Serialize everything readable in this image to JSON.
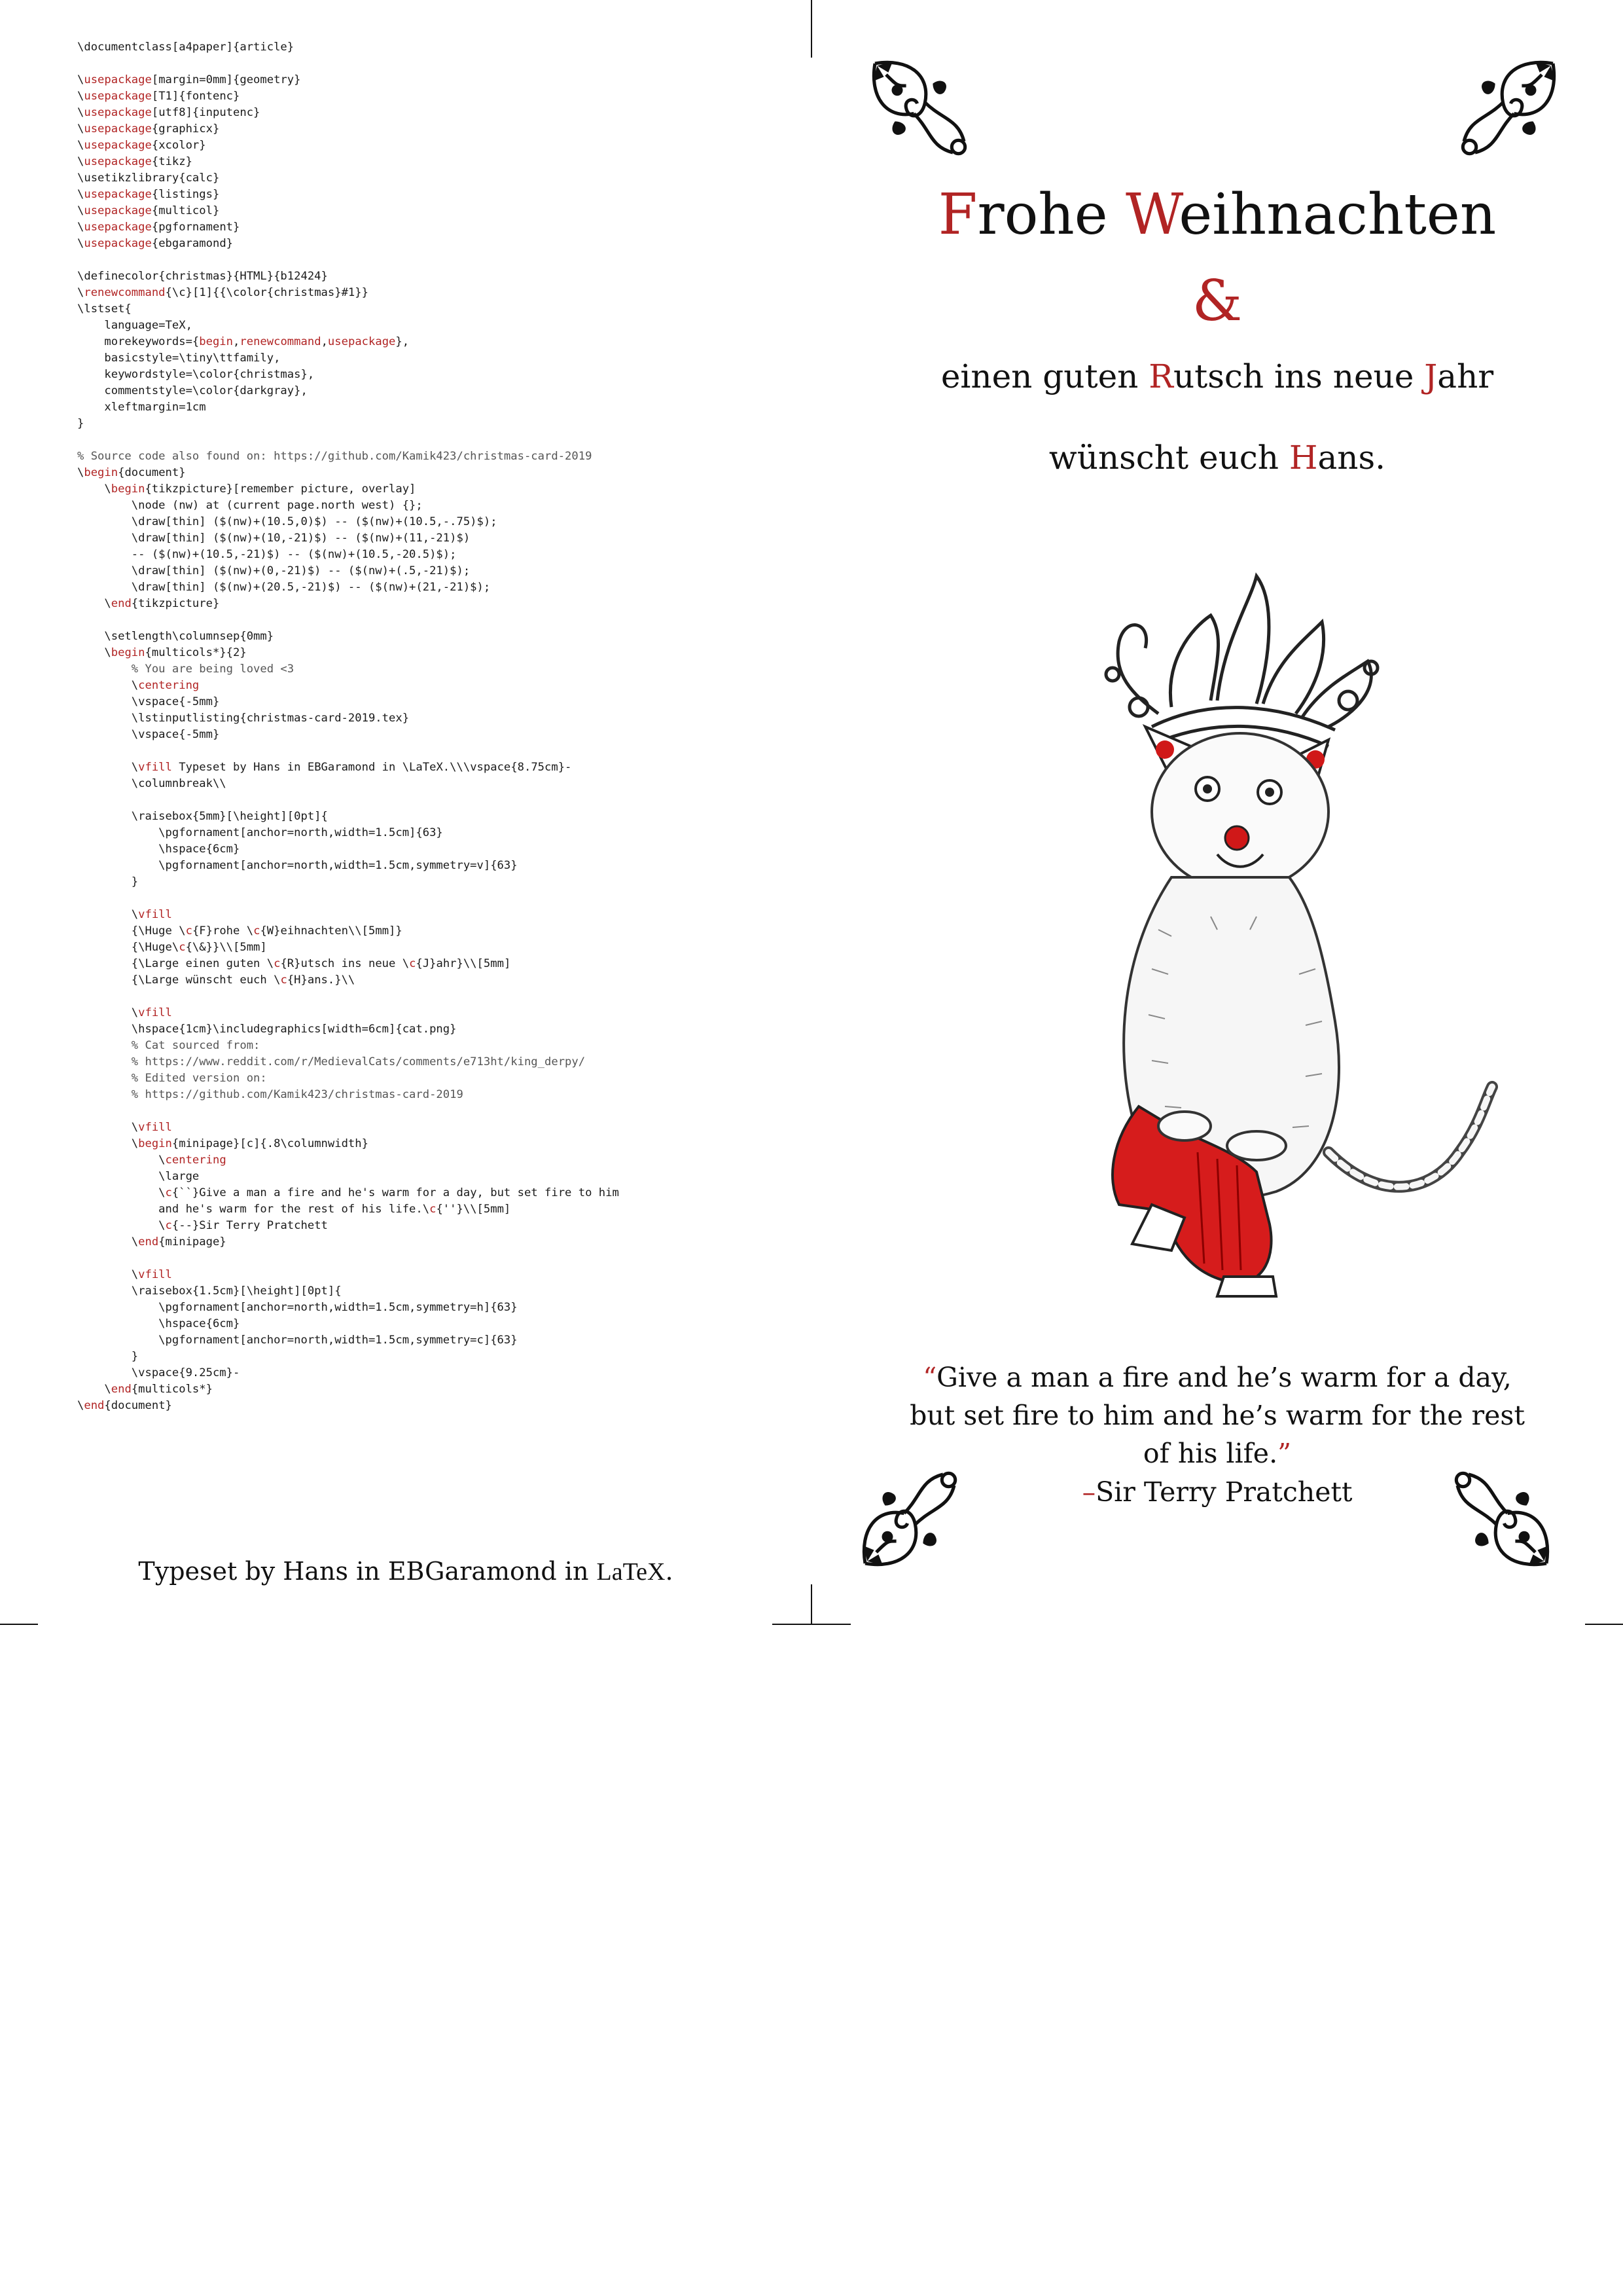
{
  "code_listing": {
    "lines": [
      [
        {
          "t": "\\documentclass[a4paper]{article}"
        }
      ],
      [],
      [
        {
          "t": "\\"
        },
        {
          "t": "usepackage",
          "c": "kw"
        },
        {
          "t": "[margin=0mm]{geometry}"
        }
      ],
      [
        {
          "t": "\\"
        },
        {
          "t": "usepackage",
          "c": "kw"
        },
        {
          "t": "[T1]{fontenc}"
        }
      ],
      [
        {
          "t": "\\"
        },
        {
          "t": "usepackage",
          "c": "kw"
        },
        {
          "t": "[utf8]{inputenc}"
        }
      ],
      [
        {
          "t": "\\"
        },
        {
          "t": "usepackage",
          "c": "kw"
        },
        {
          "t": "{graphicx}"
        }
      ],
      [
        {
          "t": "\\"
        },
        {
          "t": "usepackage",
          "c": "kw"
        },
        {
          "t": "{xcolor}"
        }
      ],
      [
        {
          "t": "\\"
        },
        {
          "t": "usepackage",
          "c": "kw"
        },
        {
          "t": "{tikz}"
        }
      ],
      [
        {
          "t": "\\usetikzlibrary{calc}"
        }
      ],
      [
        {
          "t": "\\"
        },
        {
          "t": "usepackage",
          "c": "kw"
        },
        {
          "t": "{listings}"
        }
      ],
      [
        {
          "t": "\\"
        },
        {
          "t": "usepackage",
          "c": "kw"
        },
        {
          "t": "{multicol}"
        }
      ],
      [
        {
          "t": "\\"
        },
        {
          "t": "usepackage",
          "c": "kw"
        },
        {
          "t": "{pgfornament}"
        }
      ],
      [
        {
          "t": "\\"
        },
        {
          "t": "usepackage",
          "c": "kw"
        },
        {
          "t": "{ebgaramond}"
        }
      ],
      [],
      [
        {
          "t": "\\definecolor{christmas}{HTML}{b12424}"
        }
      ],
      [
        {
          "t": "\\"
        },
        {
          "t": "renewcommand",
          "c": "kw"
        },
        {
          "t": "{\\c}[1]{{\\color{christmas}#1}}"
        }
      ],
      [
        {
          "t": "\\lstset{"
        }
      ],
      [
        {
          "t": "    language=TeX,"
        }
      ],
      [
        {
          "t": "    morekeywords={"
        },
        {
          "t": "begin",
          "c": "kw"
        },
        {
          "t": ","
        },
        {
          "t": "renewcommand",
          "c": "kw"
        },
        {
          "t": ","
        },
        {
          "t": "usepackage",
          "c": "kw"
        },
        {
          "t": "},"
        }
      ],
      [
        {
          "t": "    basicstyle=\\tiny\\ttfamily,"
        }
      ],
      [
        {
          "t": "    keywordstyle=\\color{christmas},"
        }
      ],
      [
        {
          "t": "    commentstyle=\\color{darkgray},"
        }
      ],
      [
        {
          "t": "    xleftmargin=1cm"
        }
      ],
      [
        {
          "t": "}"
        }
      ],
      [],
      [
        {
          "t": "% Source code also found on: https://github.com/Kamik423/christmas-card-2019",
          "c": "cm"
        }
      ],
      [
        {
          "t": "\\"
        },
        {
          "t": "begin",
          "c": "kw"
        },
        {
          "t": "{document}"
        }
      ],
      [
        {
          "t": "    \\"
        },
        {
          "t": "begin",
          "c": "kw"
        },
        {
          "t": "{tikzpicture}[remember picture, overlay]"
        }
      ],
      [
        {
          "t": "        \\node (nw) at (current page.north west) {};"
        }
      ],
      [
        {
          "t": "        \\draw[thin] ($(nw)+(10.5,0)$) -- ($(nw)+(10.5,-.75)$);"
        }
      ],
      [
        {
          "t": "        \\draw[thin] ($(nw)+(10,-21)$) -- ($(nw)+(11,-21)$)"
        }
      ],
      [
        {
          "t": "        -- ($(nw)+(10.5,-21)$) -- ($(nw)+(10.5,-20.5)$);"
        }
      ],
      [
        {
          "t": "        \\draw[thin] ($(nw)+(0,-21)$) -- ($(nw)+(.5,-21)$);"
        }
      ],
      [
        {
          "t": "        \\draw[thin] ($(nw)+(20.5,-21)$) -- ($(nw)+(21,-21)$);"
        }
      ],
      [
        {
          "t": "    \\"
        },
        {
          "t": "end",
          "c": "kw"
        },
        {
          "t": "{tikzpicture}"
        }
      ],
      [],
      [
        {
          "t": "    \\setlength\\columnsep{0mm}"
        }
      ],
      [
        {
          "t": "    \\"
        },
        {
          "t": "begin",
          "c": "kw"
        },
        {
          "t": "{multicols*}{2}"
        }
      ],
      [
        {
          "t": "        % You are being loved <3",
          "c": "cm"
        }
      ],
      [
        {
          "t": "        \\"
        },
        {
          "t": "centering",
          "c": "kw"
        }
      ],
      [
        {
          "t": "        \\vspace{-5mm}"
        }
      ],
      [
        {
          "t": "        \\lstinputlisting{christmas-card-2019.tex}"
        }
      ],
      [
        {
          "t": "        \\vspace{-5mm}"
        }
      ],
      [],
      [
        {
          "t": "        \\"
        },
        {
          "t": "vfill",
          "c": "kw"
        },
        {
          "t": " Typeset by Hans in EBGaramond in \\LaTeX.\\\\\\vspace{8.75cm}-"
        }
      ],
      [
        {
          "t": "        \\columnbreak\\\\"
        }
      ],
      [],
      [
        {
          "t": "        \\raisebox{5mm}[\\height][0pt]{"
        }
      ],
      [
        {
          "t": "            \\pgfornament[anchor=north,width=1.5cm]{63}"
        }
      ],
      [
        {
          "t": "            \\hspace{6cm}"
        }
      ],
      [
        {
          "t": "            \\pgfornament[anchor=north,width=1.5cm,symmetry=v]{63}"
        }
      ],
      [
        {
          "t": "        }"
        }
      ],
      [],
      [
        {
          "t": "        \\"
        },
        {
          "t": "vfill",
          "c": "kw"
        }
      ],
      [
        {
          "t": "        {\\Huge \\"
        },
        {
          "t": "c",
          "c": "kw"
        },
        {
          "t": "{F}rohe \\"
        },
        {
          "t": "c",
          "c": "kw"
        },
        {
          "t": "{W}eihnachten\\\\[5mm]}"
        }
      ],
      [
        {
          "t": "        {\\Huge\\"
        },
        {
          "t": "c",
          "c": "kw"
        },
        {
          "t": "{\\&}}\\\\[5mm]"
        }
      ],
      [
        {
          "t": "        {\\Large einen guten \\"
        },
        {
          "t": "c",
          "c": "kw"
        },
        {
          "t": "{R}utsch ins neue \\"
        },
        {
          "t": "c",
          "c": "kw"
        },
        {
          "t": "{J}ahr}\\\\[5mm]"
        }
      ],
      [
        {
          "t": "        {\\Large wünscht euch \\"
        },
        {
          "t": "c",
          "c": "kw"
        },
        {
          "t": "{H}ans.}\\\\"
        }
      ],
      [],
      [
        {
          "t": "        \\"
        },
        {
          "t": "vfill",
          "c": "kw"
        }
      ],
      [
        {
          "t": "        \\hspace{1cm}\\includegraphics[width=6cm]{cat.png}"
        }
      ],
      [
        {
          "t": "        % Cat sourced from:",
          "c": "cm"
        }
      ],
      [
        {
          "t": "        % https://www.reddit.com/r/MedievalCats/comments/e713ht/king_derpy/",
          "c": "cm"
        }
      ],
      [
        {
          "t": "        % Edited version on:",
          "c": "cm"
        }
      ],
      [
        {
          "t": "        % https://github.com/Kamik423/christmas-card-2019",
          "c": "cm"
        }
      ],
      [],
      [
        {
          "t": "        \\"
        },
        {
          "t": "vfill",
          "c": "kw"
        }
      ],
      [
        {
          "t": "        \\"
        },
        {
          "t": "begin",
          "c": "kw"
        },
        {
          "t": "{minipage}[c]{.8\\columnwidth}"
        }
      ],
      [
        {
          "t": "            \\"
        },
        {
          "t": "centering",
          "c": "kw"
        }
      ],
      [
        {
          "t": "            \\large"
        }
      ],
      [
        {
          "t": "            \\"
        },
        {
          "t": "c",
          "c": "kw"
        },
        {
          "t": "{``}Give a man a fire and he's warm for a day, but set fire to him"
        }
      ],
      [
        {
          "t": "            and he's warm for the rest of his life.\\"
        },
        {
          "t": "c",
          "c": "kw"
        },
        {
          "t": "{''}\\\\[5mm]"
        }
      ],
      [
        {
          "t": "            \\"
        },
        {
          "t": "c",
          "c": "kw"
        },
        {
          "t": "{--}Sir Terry Pratchett"
        }
      ],
      [
        {
          "t": "        \\"
        },
        {
          "t": "end",
          "c": "kw"
        },
        {
          "t": "{minipage}"
        }
      ],
      [],
      [
        {
          "t": "        \\"
        },
        {
          "t": "vfill",
          "c": "kw"
        }
      ],
      [
        {
          "t": "        \\raisebox{1.5cm}[\\height][0pt]{"
        }
      ],
      [
        {
          "t": "            \\pgfornament[anchor=north,width=1.5cm,symmetry=h]{63}"
        }
      ],
      [
        {
          "t": "            \\hspace{6cm}"
        }
      ],
      [
        {
          "t": "            \\pgfornament[anchor=north,width=1.5cm,symmetry=c]{63}"
        }
      ],
      [
        {
          "t": "        }"
        }
      ],
      [
        {
          "t": "        \\vspace{9.25cm}-"
        }
      ],
      [
        {
          "t": "    \\"
        },
        {
          "t": "end",
          "c": "kw"
        },
        {
          "t": "{multicols*}"
        }
      ],
      [
        {
          "t": "\\"
        },
        {
          "t": "end",
          "c": "kw"
        },
        {
          "t": "{document}"
        }
      ]
    ]
  },
  "typeset_line": {
    "text": "Typeset by Hans in EBGaramond in ",
    "latex": "LaTeX",
    "period": "."
  },
  "card": {
    "title": {
      "f": "F",
      "rohe": "rohe ",
      "w": "W",
      "eihnachten": "eihnachten"
    },
    "ampersand": "&",
    "line2": {
      "a": "einen guten ",
      "r": "R",
      "b": "utsch ins neue ",
      "j": "J",
      "c": "ahr"
    },
    "line3": {
      "a": "wünscht euch ",
      "h": "H",
      "b": "ans."
    },
    "quote": {
      "open": "“",
      "text": "Give a man a fire and he’s warm for a day, but set fire to him and he’s warm for the rest of his life.",
      "close": "”"
    },
    "author": {
      "dash": "–",
      "name": "Sir Terry Pratchett"
    }
  },
  "colors": {
    "accent_red": "#b12424",
    "comment_gray": "#555555",
    "ink": "#111111"
  },
  "icons": [
    "corner-ornament-icon",
    "cat-illustration"
  ]
}
